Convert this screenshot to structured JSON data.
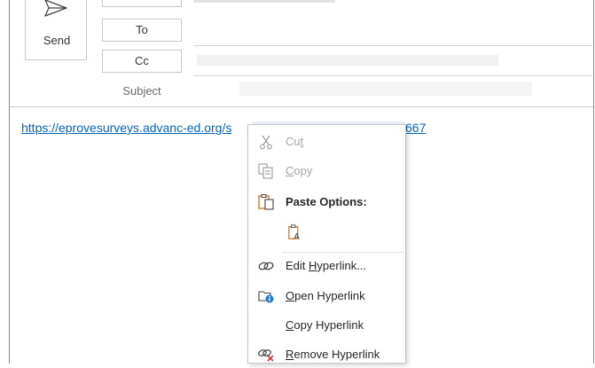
{
  "compose": {
    "send_label": "Send",
    "to_label": "To",
    "cc_label": "Cc",
    "subject_label": "Subject"
  },
  "body": {
    "link_text_visible": "https://eprovesurveys.advanc-ed.org/s",
    "link_tail_visible": "667"
  },
  "context_menu": {
    "cut": {
      "prefix": "Cu",
      "underline": "t",
      "suffix": ""
    },
    "copy": {
      "prefix": "",
      "underline": "C",
      "suffix": "opy"
    },
    "paste_options": "Paste Options:",
    "edit_hyperlink": {
      "prefix": "Edit ",
      "underline": "H",
      "suffix": "yperlink..."
    },
    "open_hyperlink": {
      "prefix": "",
      "underline": "O",
      "suffix": "pen Hyperlink"
    },
    "copy_hyperlink": {
      "prefix": "",
      "underline": "C",
      "suffix": "opy Hyperlink"
    },
    "remove_hyperlink": {
      "prefix": "",
      "underline": "R",
      "suffix": "emove Hyperlink"
    }
  },
  "colors": {
    "link": "#0563c1",
    "accent_orange": "#d47b22",
    "info_blue": "#1e7bd6",
    "remove_red": "#d13438"
  }
}
